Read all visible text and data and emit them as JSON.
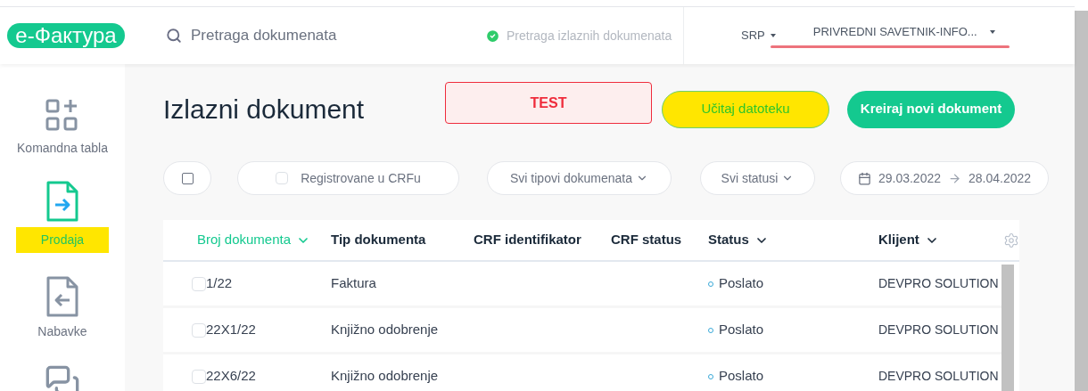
{
  "header": {
    "logo": "е-Фактура",
    "search": {
      "placeholder": "Pretraga dokumenata"
    },
    "scope": {
      "label": "Pretraga izlaznih dokumenata",
      "checked": true
    },
    "language": "SRP",
    "company": "PRIVREDNI SAVETNIK-INFO..."
  },
  "sidebar": {
    "items": [
      {
        "kind": "dashboard",
        "label": "Komandna tabla",
        "selected": false
      },
      {
        "kind": "outgoing",
        "label": "Prodaja",
        "selected": true
      },
      {
        "kind": "incoming",
        "label": "Nabavke",
        "selected": false
      },
      {
        "kind": "chat",
        "selected": false
      }
    ]
  },
  "page": {
    "title": "Izlazni dokument",
    "environment": "TEST",
    "upload_button": "Učitaj datoteku",
    "create_button": "Kreiraj novi dokument"
  },
  "filters": {
    "select_all": {
      "checked": false
    },
    "registered": {
      "label": "Registrovane u CRFu",
      "checked": false
    },
    "document_types": "Svi tipovi dokumenata",
    "statuses": "Svi statusi",
    "date_from": "29.03.2022",
    "date_to": "28.04.2022"
  },
  "table": {
    "columns": [
      {
        "label": "Broj dokumenta",
        "sortable": true,
        "selected": true
      },
      {
        "label": "Tip dokumenta",
        "sortable": false,
        "selected": false
      },
      {
        "label": "CRF identifikator",
        "sortable": false,
        "selected": false
      },
      {
        "label": "CRF status",
        "sortable": false,
        "selected": false
      },
      {
        "label": "Status",
        "sortable": true,
        "selected": false
      },
      {
        "label": "Klijent",
        "sortable": true,
        "selected": false
      }
    ],
    "rows": [
      {
        "checked": false,
        "cells": [
          "1/22",
          "Faktura",
          "",
          "",
          "Poslato",
          "DEVPRO SOLUTION"
        ]
      },
      {
        "checked": false,
        "cells": [
          "22X1/22",
          "Knjižno odobrenje",
          "",
          "",
          "Poslato",
          "DEVPRO SOLUTION"
        ]
      },
      {
        "checked": false,
        "cells": [
          "22X6/22",
          "Knjižno odobrenje",
          "",
          "",
          "Poslato",
          "DEVPRO SOLUTION"
        ]
      }
    ]
  }
}
